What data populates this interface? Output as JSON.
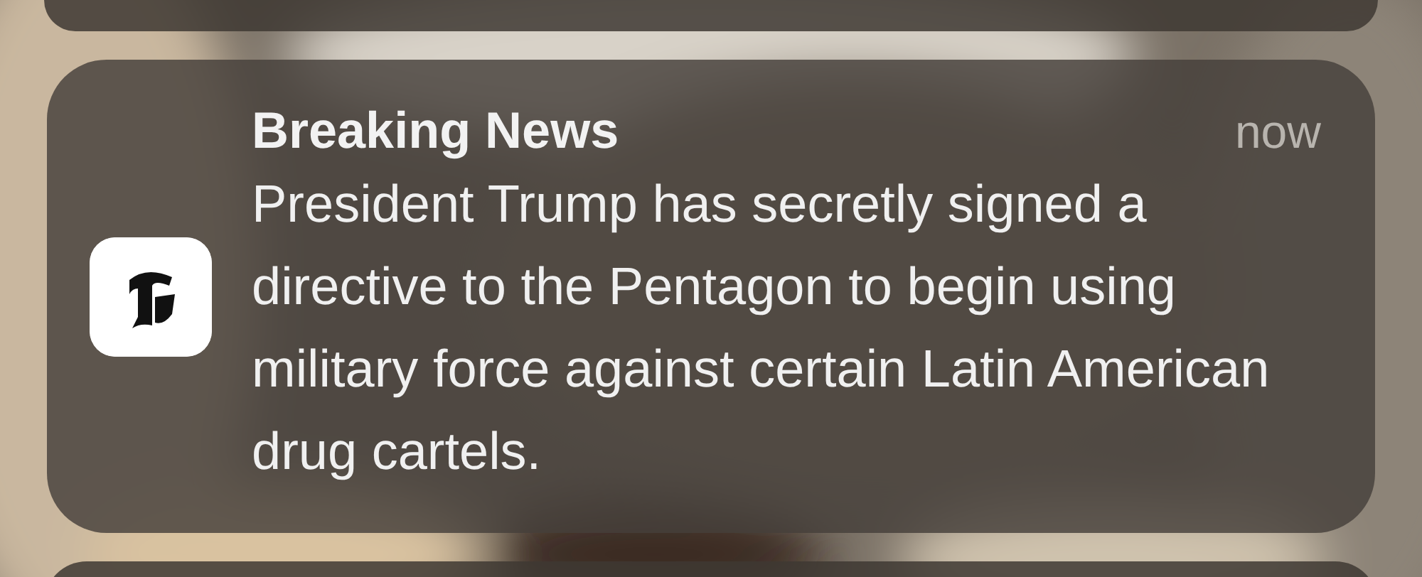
{
  "notification": {
    "title": "Breaking News",
    "time": "now",
    "body": "President Trump has secretly signed a directive to the Pentagon to begin using military force against certain Latin American drug cartels."
  }
}
